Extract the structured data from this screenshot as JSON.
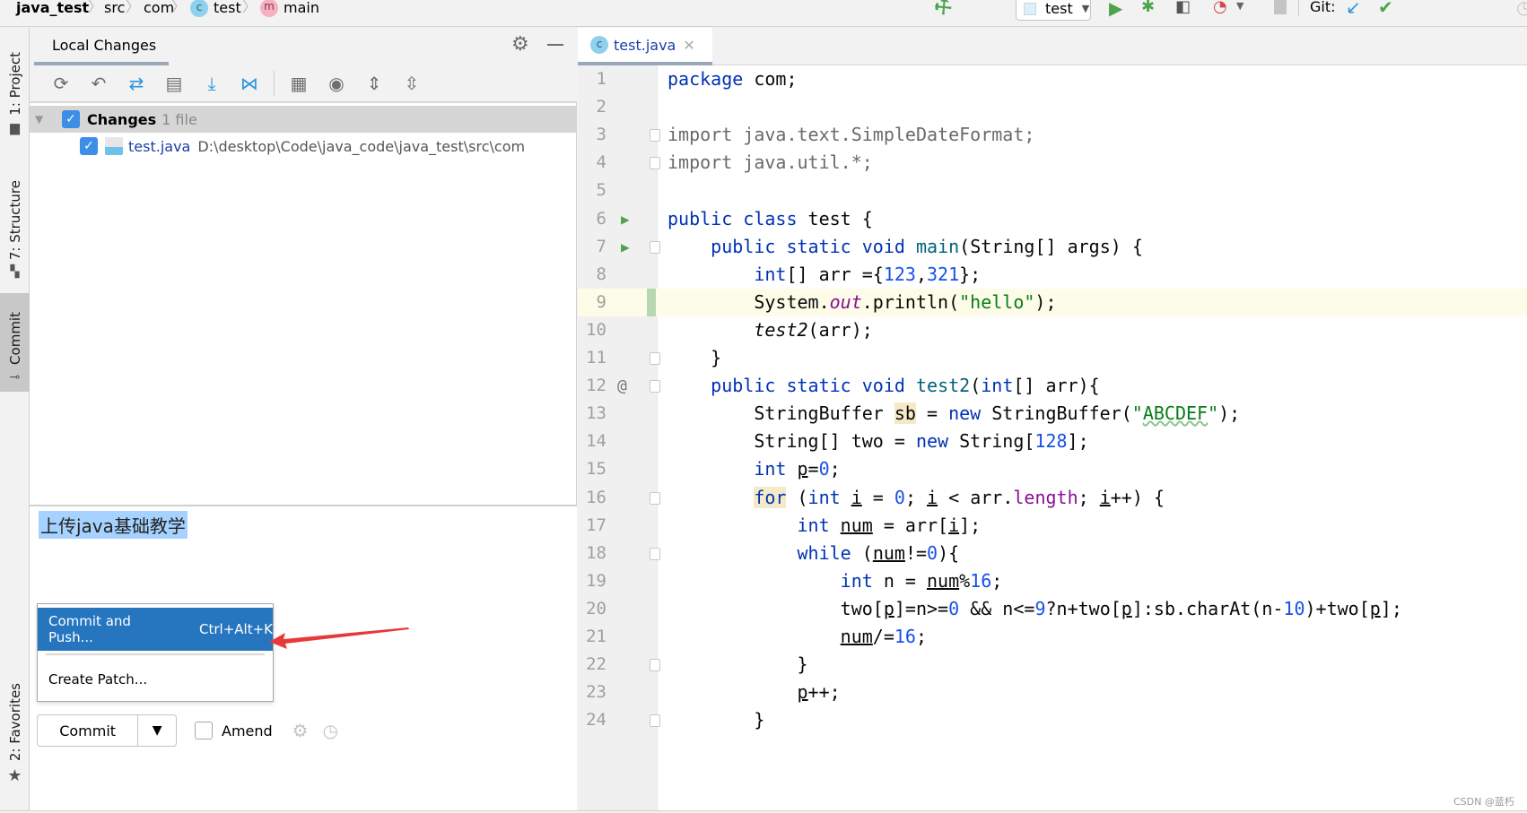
{
  "navbar": {
    "breadcrumbs": [
      {
        "label": "java_test",
        "icon": null
      },
      {
        "label": "src",
        "icon": null
      },
      {
        "label": "com",
        "icon": null
      },
      {
        "label": "test",
        "icon": "class-icon"
      },
      {
        "label": "main",
        "icon": "method-icon"
      }
    ],
    "run_config": "test",
    "git_label": "Git:",
    "icons": [
      "build-hammer-icon",
      "run-icon",
      "debug-icon",
      "coverage-icon",
      "profiler-icon",
      "stop-icon",
      "git-update-icon",
      "git-commit-icon",
      "git-history-icon"
    ]
  },
  "tool_stripe": {
    "left_tabs": [
      {
        "label": "1: Project",
        "icon": "folder-icon",
        "active": false
      },
      {
        "label": "7: Structure",
        "icon": "structure-icon",
        "active": false
      },
      {
        "label": "Commit",
        "icon": "commit-icon",
        "active": true
      },
      {
        "label": "2: Favorites",
        "icon": "star-icon",
        "active": false
      }
    ]
  },
  "commit_panel": {
    "tab_label": "Local Changes",
    "toolbar_icons": [
      "refresh-icon",
      "rollback-icon",
      "show-diff-icon",
      "shelve-icon",
      "update-icon",
      "merge-icon",
      "group-by-icon",
      "view-options-icon",
      "expand-all-icon",
      "collapse-all-icon"
    ],
    "changelist": {
      "name": "Changes",
      "count_text": "1 file",
      "checked": true
    },
    "files": [
      {
        "name": "test.java",
        "path": "D:\\desktop\\Code\\java_code\\java_test\\src\\com",
        "checked": true
      }
    ],
    "commit_message": "上传java基础教学",
    "popup_menu": [
      {
        "label": "Commit and Push...",
        "shortcut": "Ctrl+Alt+K",
        "highlighted": true
      },
      {
        "label": "Create Patch...",
        "shortcut": "",
        "highlighted": false
      }
    ],
    "commit_button": "Commit",
    "amend_label": "Amend",
    "amend_checked": false
  },
  "editor": {
    "tab_label": "test.java",
    "caret_line": 9,
    "lines": [
      {
        "n": 1,
        "text": "package com;"
      },
      {
        "n": 2,
        "text": ""
      },
      {
        "n": 3,
        "text": "import java.text.SimpleDateFormat;"
      },
      {
        "n": 4,
        "text": "import java.util.*;"
      },
      {
        "n": 5,
        "text": ""
      },
      {
        "n": 6,
        "text": "public class test {"
      },
      {
        "n": 7,
        "text": "    public static void main(String[] args) {"
      },
      {
        "n": 8,
        "text": "        int[] arr ={123,321};"
      },
      {
        "n": 9,
        "text": "        System.out.println(\"hello\");"
      },
      {
        "n": 10,
        "text": "        test2(arr);"
      },
      {
        "n": 11,
        "text": "    }"
      },
      {
        "n": 12,
        "text": "    public static void test2(int[] arr){"
      },
      {
        "n": 13,
        "text": "        StringBuffer sb = new StringBuffer(\"ABCDEF\");"
      },
      {
        "n": 14,
        "text": "        String[] two = new String[128];"
      },
      {
        "n": 15,
        "text": "        int p=0;"
      },
      {
        "n": 16,
        "text": "        for (int i = 0; i < arr.length; i++) {"
      },
      {
        "n": 17,
        "text": "            int num = arr[i];"
      },
      {
        "n": 18,
        "text": "            while (num!=0){"
      },
      {
        "n": 19,
        "text": "                int n = num%16;"
      },
      {
        "n": 20,
        "text": "                two[p]=n>=0 && n<=9?n+two[p]:sb.charAt(n-10)+two[p];"
      },
      {
        "n": 21,
        "text": "                num/=16;"
      },
      {
        "n": 22,
        "text": "            }"
      },
      {
        "n": 23,
        "text": "            p++;"
      },
      {
        "n": 24,
        "text": "        }"
      }
    ]
  },
  "watermark": "CSDN @蓝朽"
}
